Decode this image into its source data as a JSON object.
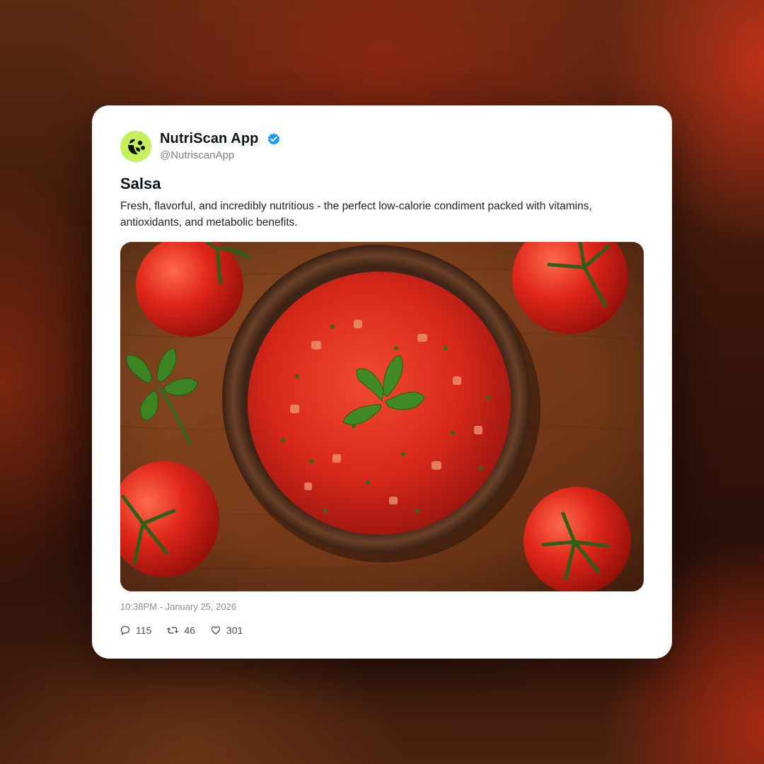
{
  "account": {
    "display_name": "NutriScan App",
    "handle": "@NutriscanApp",
    "verified": true,
    "avatar_icon": "leaf-logo-icon",
    "avatar_color": "#c4f05c"
  },
  "post": {
    "title": "Salsa",
    "body": "Fresh, flavorful, and incredibly nutritious - the perfect low-calorie condiment packed with vitamins, antioxidants, and metabolic benefits.",
    "image_subject": "salsa-bowl-photo",
    "timestamp": "10:38PM - January 25, 2026"
  },
  "metrics": {
    "replies": {
      "icon": "comment-icon",
      "count": "115"
    },
    "reposts": {
      "icon": "repost-icon",
      "count": "46"
    },
    "likes": {
      "icon": "heart-icon",
      "count": "301"
    }
  },
  "colors": {
    "verified_badge": "#1d9bf0",
    "card_background": "#ffffff",
    "text_primary": "#0f1419",
    "text_secondary": "#7a7f86"
  }
}
